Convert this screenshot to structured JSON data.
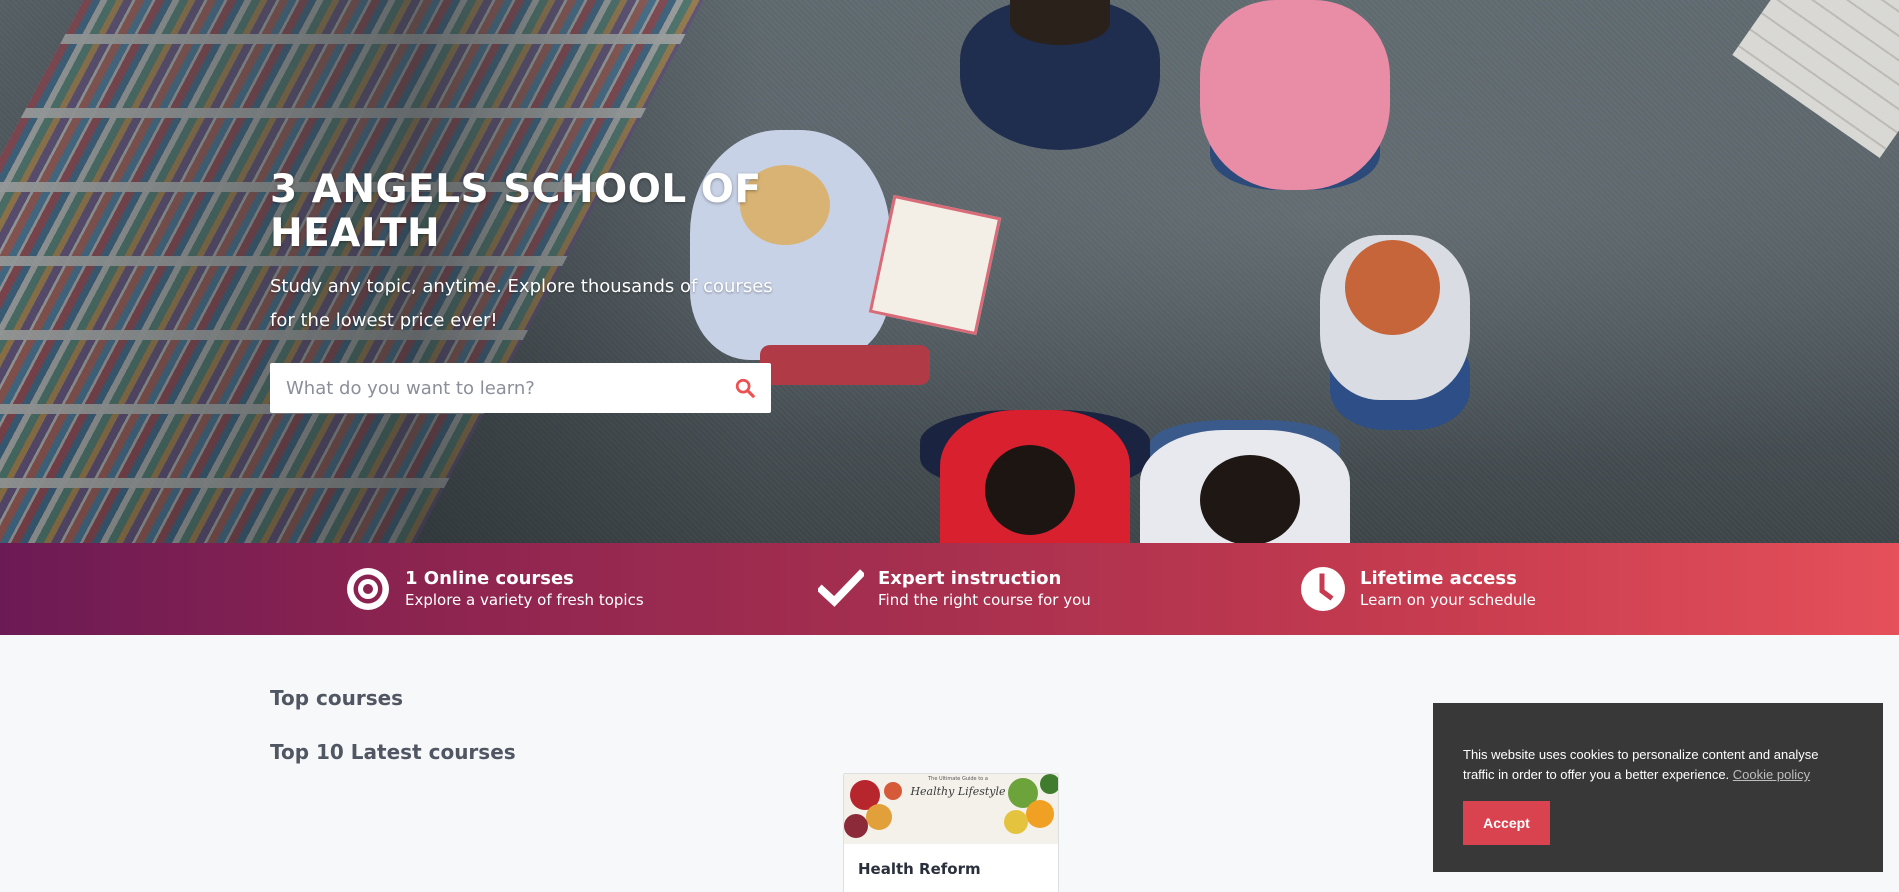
{
  "hero": {
    "title": "3 ANGELS SCHOOL OF HEALTH",
    "subtitle": "Study any topic, anytime. Explore thousands of courses for the lowest price ever!",
    "search": {
      "placeholder": "What do you want to learn?",
      "value": "",
      "button_icon": "search-icon"
    }
  },
  "features": [
    {
      "icon": "target-icon",
      "title": "1 Online courses",
      "description": "Explore a variety of fresh topics"
    },
    {
      "icon": "checkmark-icon",
      "title": "Expert instruction",
      "description": "Find the right course for you"
    },
    {
      "icon": "clock-icon",
      "title": "Lifetime access",
      "description": "Learn on your schedule"
    }
  ],
  "main": {
    "top_courses_heading": "Top courses",
    "latest_courses_heading": "Top 10 Latest courses",
    "courses": [
      {
        "title": "Health Reform",
        "thumbnail": {
          "caption_small": "The Ultimate Guide to a",
          "caption": "Healthy Lifestyle"
        }
      }
    ]
  },
  "cookie_banner": {
    "message": "This website uses cookies to personalize content and analyse traffic in order to offer you a better experience.",
    "policy_link": "Cookie policy",
    "accept_label": "Accept"
  },
  "colors": {
    "accent": "#ec5252",
    "gradient_start": "#6c1a55",
    "gradient_end": "#e5505a",
    "cookie_bg": "#383838",
    "accept_button": "#d9434f"
  }
}
